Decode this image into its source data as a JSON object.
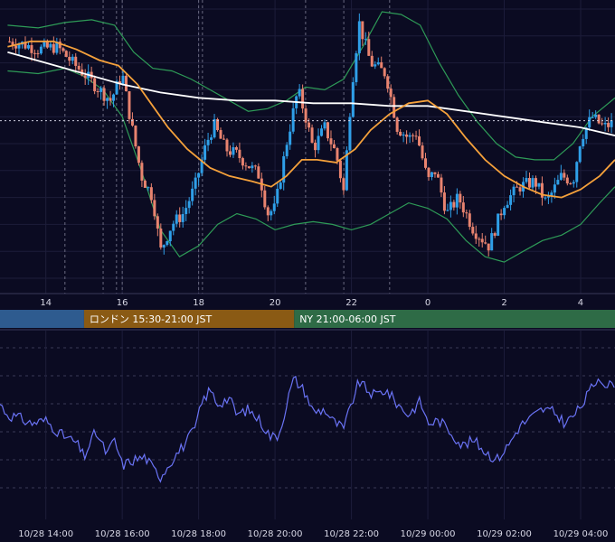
{
  "chart_data": [
    {
      "type": "candlestick",
      "panel": "price",
      "x_unit": "hours since 10/28 12:00 JST",
      "x_range": [
        12.8,
        28.9
      ],
      "y_unit": "price (unlabeled)",
      "y_range": [
        0,
        100
      ],
      "grid": true,
      "x_ticks": [
        {
          "x": 14,
          "label": "14"
        },
        {
          "x": 16,
          "label": "16"
        },
        {
          "x": 18,
          "label": "18"
        },
        {
          "x": 20,
          "label": "20"
        },
        {
          "x": 22,
          "label": "22"
        },
        {
          "x": 24,
          "label": "0"
        },
        {
          "x": 26,
          "label": "2"
        },
        {
          "x": 28,
          "label": "4"
        }
      ],
      "current_price": 58.5,
      "colors": {
        "up": "#2f9fe8",
        "down": "#e8836f",
        "ma_short": "#f5a13b",
        "ma_long": "#ffffff",
        "bands": "#2e9b57"
      },
      "close_path": [
        [
          13.0,
          88
        ],
        [
          13.4,
          87
        ],
        [
          13.8,
          85
        ],
        [
          14.3,
          86
        ],
        [
          14.7,
          80
        ],
        [
          15.0,
          76
        ],
        [
          15.4,
          70
        ],
        [
          15.7,
          66
        ],
        [
          16.0,
          76
        ],
        [
          16.2,
          60
        ],
        [
          16.5,
          38
        ],
        [
          16.8,
          30
        ],
        [
          17.0,
          10
        ],
        [
          17.3,
          20
        ],
        [
          17.6,
          24
        ],
        [
          17.9,
          34
        ],
        [
          18.2,
          50
        ],
        [
          18.4,
          57
        ],
        [
          18.7,
          48
        ],
        [
          19.0,
          46
        ],
        [
          19.3,
          42
        ],
        [
          19.6,
          38
        ],
        [
          19.8,
          24
        ],
        [
          20.0,
          26
        ],
        [
          20.3,
          50
        ],
        [
          20.6,
          70
        ],
        [
          20.8,
          60
        ],
        [
          21.0,
          48
        ],
        [
          21.3,
          56
        ],
        [
          21.6,
          46
        ],
        [
          21.8,
          32
        ],
        [
          22.0,
          70
        ],
        [
          22.2,
          95
        ],
        [
          22.5,
          80
        ],
        [
          22.9,
          76
        ],
        [
          23.2,
          56
        ],
        [
          23.5,
          52
        ],
        [
          23.7,
          54
        ],
        [
          24.0,
          36
        ],
        [
          24.2,
          40
        ],
        [
          24.5,
          24
        ],
        [
          24.8,
          30
        ],
        [
          25.2,
          18
        ],
        [
          25.6,
          12
        ],
        [
          26.0,
          28
        ],
        [
          26.4,
          34
        ],
        [
          26.8,
          36
        ],
        [
          27.1,
          28
        ],
        [
          27.5,
          38
        ],
        [
          27.8,
          36
        ],
        [
          28.0,
          52
        ],
        [
          28.3,
          60
        ],
        [
          28.6,
          56
        ],
        [
          28.9,
          58
        ]
      ],
      "ma_short": [
        [
          13.0,
          86
        ],
        [
          13.6,
          88
        ],
        [
          14.2,
          88
        ],
        [
          14.8,
          85
        ],
        [
          15.4,
          81
        ],
        [
          15.9,
          79
        ],
        [
          16.4,
          72
        ],
        [
          16.8,
          64
        ],
        [
          17.2,
          56
        ],
        [
          17.7,
          48
        ],
        [
          18.3,
          41
        ],
        [
          18.8,
          38
        ],
        [
          19.4,
          36
        ],
        [
          19.9,
          34
        ],
        [
          20.3,
          38
        ],
        [
          20.7,
          44
        ],
        [
          21.1,
          44
        ],
        [
          21.6,
          43
        ],
        [
          22.1,
          48
        ],
        [
          22.5,
          55
        ],
        [
          23.0,
          61
        ],
        [
          23.5,
          65
        ],
        [
          24.0,
          66
        ],
        [
          24.5,
          61
        ],
        [
          25.0,
          52
        ],
        [
          25.5,
          44
        ],
        [
          26.0,
          38
        ],
        [
          26.5,
          34
        ],
        [
          27.0,
          31
        ],
        [
          27.5,
          30
        ],
        [
          28.0,
          33
        ],
        [
          28.5,
          38
        ],
        [
          28.9,
          44
        ]
      ],
      "ma_long": [
        [
          13.0,
          84
        ],
        [
          14.0,
          80
        ],
        [
          15.0,
          76
        ],
        [
          16.0,
          72
        ],
        [
          17.0,
          69
        ],
        [
          18.0,
          67
        ],
        [
          19.0,
          66
        ],
        [
          20.0,
          66
        ],
        [
          21.0,
          65
        ],
        [
          22.0,
          65
        ],
        [
          23.0,
          64
        ],
        [
          24.0,
          64
        ],
        [
          25.0,
          62
        ],
        [
          26.0,
          60
        ],
        [
          27.0,
          58
        ],
        [
          28.0,
          56
        ],
        [
          28.9,
          53
        ]
      ],
      "band_upper": [
        [
          13.0,
          94
        ],
        [
          13.8,
          93
        ],
        [
          14.5,
          95
        ],
        [
          15.2,
          96
        ],
        [
          15.8,
          94
        ],
        [
          16.3,
          84
        ],
        [
          16.8,
          78
        ],
        [
          17.3,
          77
        ],
        [
          17.8,
          74
        ],
        [
          18.3,
          70
        ],
        [
          18.8,
          66
        ],
        [
          19.3,
          62
        ],
        [
          19.8,
          63
        ],
        [
          20.3,
          66
        ],
        [
          20.8,
          71
        ],
        [
          21.3,
          70
        ],
        [
          21.8,
          74
        ],
        [
          22.3,
          86
        ],
        [
          22.8,
          99
        ],
        [
          23.3,
          98
        ],
        [
          23.8,
          94
        ],
        [
          24.3,
          80
        ],
        [
          24.8,
          68
        ],
        [
          25.3,
          58
        ],
        [
          25.8,
          50
        ],
        [
          26.3,
          45
        ],
        [
          26.8,
          44
        ],
        [
          27.3,
          44
        ],
        [
          27.8,
          50
        ],
        [
          28.3,
          60
        ],
        [
          28.9,
          67
        ]
      ],
      "band_lower": [
        [
          13.0,
          77
        ],
        [
          13.8,
          76
        ],
        [
          14.5,
          78
        ],
        [
          15.0,
          75
        ],
        [
          15.5,
          70
        ],
        [
          16.0,
          60
        ],
        [
          16.5,
          40
        ],
        [
          17.0,
          18
        ],
        [
          17.5,
          8
        ],
        [
          18.0,
          12
        ],
        [
          18.5,
          20
        ],
        [
          19.0,
          24
        ],
        [
          19.5,
          22
        ],
        [
          20.0,
          18
        ],
        [
          20.5,
          20
        ],
        [
          21.0,
          21
        ],
        [
          21.5,
          20
        ],
        [
          22.0,
          18
        ],
        [
          22.5,
          20
        ],
        [
          23.0,
          24
        ],
        [
          23.5,
          28
        ],
        [
          24.0,
          26
        ],
        [
          24.5,
          22
        ],
        [
          25.0,
          14
        ],
        [
          25.5,
          8
        ],
        [
          26.0,
          6
        ],
        [
          26.5,
          10
        ],
        [
          27.0,
          14
        ],
        [
          27.5,
          16
        ],
        [
          28.0,
          20
        ],
        [
          28.5,
          28
        ],
        [
          28.9,
          34
        ]
      ],
      "session_dividers": [
        14.5,
        15.5,
        15.85,
        16.0,
        18.0,
        18.1,
        20.8,
        21.8,
        23.0
      ]
    },
    {
      "type": "line",
      "panel": "oscillator",
      "x_range": [
        12.8,
        28.9
      ],
      "y_range": [
        0,
        100
      ],
      "grid": true,
      "color": "#6a73f5",
      "points": [
        [
          12.8,
          60
        ],
        [
          13.0,
          52
        ],
        [
          13.3,
          50
        ],
        [
          13.6,
          46
        ],
        [
          14.0,
          48
        ],
        [
          14.4,
          38
        ],
        [
          14.8,
          32
        ],
        [
          15.0,
          22
        ],
        [
          15.3,
          40
        ],
        [
          15.6,
          24
        ],
        [
          15.8,
          34
        ],
        [
          16.0,
          16
        ],
        [
          16.3,
          20
        ],
        [
          16.6,
          22
        ],
        [
          16.8,
          14
        ],
        [
          17.0,
          8
        ],
        [
          17.3,
          20
        ],
        [
          17.6,
          30
        ],
        [
          17.9,
          42
        ],
        [
          18.1,
          62
        ],
        [
          18.3,
          70
        ],
        [
          18.5,
          60
        ],
        [
          18.8,
          64
        ],
        [
          19.0,
          52
        ],
        [
          19.3,
          56
        ],
        [
          19.6,
          48
        ],
        [
          19.9,
          36
        ],
        [
          20.1,
          38
        ],
        [
          20.4,
          70
        ],
        [
          20.5,
          78
        ],
        [
          20.8,
          68
        ],
        [
          21.0,
          54
        ],
        [
          21.3,
          56
        ],
        [
          21.5,
          48
        ],
        [
          21.8,
          42
        ],
        [
          22.0,
          60
        ],
        [
          22.2,
          76
        ],
        [
          22.4,
          70
        ],
        [
          22.6,
          66
        ],
        [
          22.9,
          70
        ],
        [
          23.2,
          60
        ],
        [
          23.5,
          52
        ],
        [
          23.8,
          62
        ],
        [
          24.0,
          46
        ],
        [
          24.3,
          48
        ],
        [
          24.6,
          40
        ],
        [
          24.9,
          30
        ],
        [
          25.2,
          34
        ],
        [
          25.5,
          26
        ],
        [
          25.8,
          20
        ],
        [
          26.1,
          30
        ],
        [
          26.4,
          44
        ],
        [
          26.7,
          50
        ],
        [
          27.0,
          56
        ],
        [
          27.3,
          54
        ],
        [
          27.6,
          46
        ],
        [
          27.9,
          54
        ],
        [
          28.1,
          62
        ],
        [
          28.3,
          72
        ],
        [
          28.5,
          80
        ],
        [
          28.7,
          72
        ],
        [
          28.9,
          76
        ]
      ],
      "x_ticks": [
        {
          "x": 14,
          "label": "10/28 14:00"
        },
        {
          "x": 16,
          "label": "10/28 16:00"
        },
        {
          "x": 18,
          "label": "10/28 18:00"
        },
        {
          "x": 20,
          "label": "10/28 20:00"
        },
        {
          "x": 22,
          "label": "10/28 22:00"
        },
        {
          "x": 24,
          "label": "10/29 00:00"
        },
        {
          "x": 26,
          "label": "10/29 02:00"
        },
        {
          "x": 28,
          "label": "10/29 04:00"
        }
      ]
    }
  ],
  "sessions": [
    {
      "start": 12.8,
      "end": 15.0,
      "label": "",
      "color": "#2e5b8f"
    },
    {
      "start": 15.0,
      "end": 20.5,
      "label": "ロンドン 15:30-21:00 JST",
      "color": "#8a5a14"
    },
    {
      "start": 20.5,
      "end": 28.9,
      "label": "NY 21:00-06:00 JST",
      "color": "#2e6b46"
    }
  ]
}
